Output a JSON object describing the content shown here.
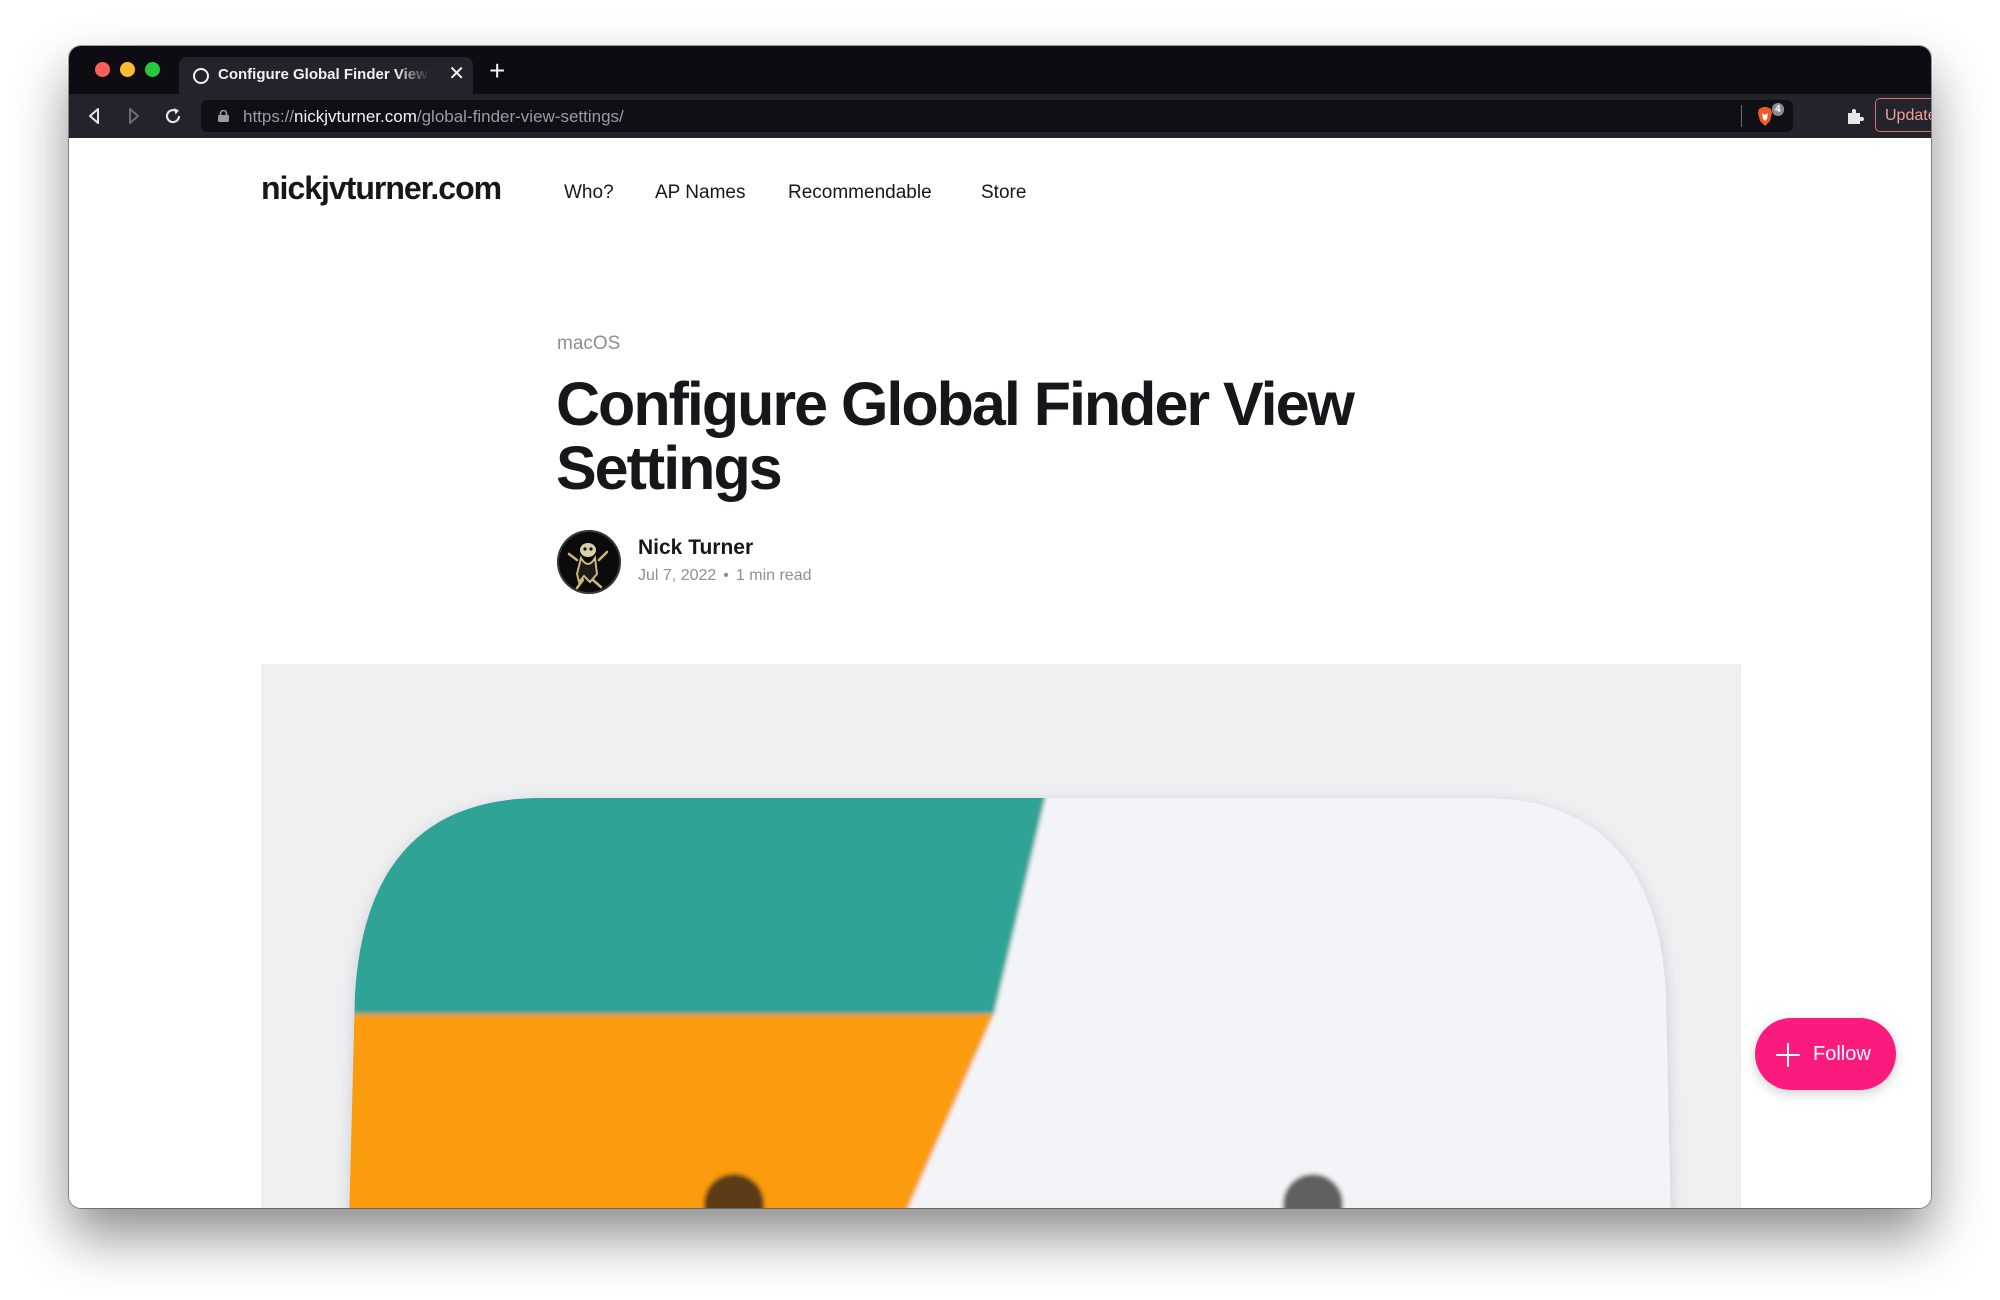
{
  "browser": {
    "tab": {
      "title": "Configure Global Finder View Settings",
      "close_glyph": "✕"
    },
    "new_tab_glyph": "+",
    "address_bar": {
      "scheme": "https://",
      "host": "nickjvturner.com",
      "path": "/global-finder-view-settings/"
    },
    "shields_count": "4",
    "update_button": "Update",
    "icons": [
      "back-icon",
      "forward-icon",
      "reload-icon",
      "lock-icon",
      "brave-shields-icon",
      "extensions-icon",
      "menu-icon"
    ]
  },
  "site": {
    "logo": "nickjvturner.com",
    "nav": [
      "Who?",
      "AP Names",
      "Recommendable",
      "Store"
    ]
  },
  "post": {
    "category": "macOS",
    "title": "Configure Global Finder View Settings",
    "author": "Nick Turner",
    "date": "Jul 7, 2022",
    "separator": "•",
    "read_time": "1 min read",
    "hero_image": "finder-icon"
  },
  "follow_button": {
    "label": "Follow",
    "icon": "plus-icon"
  },
  "colors": {
    "follow": "#fb1a7e",
    "update_accent": "#e27066",
    "finder_teal": "#2fa396",
    "finder_orange": "#fa9c10"
  }
}
